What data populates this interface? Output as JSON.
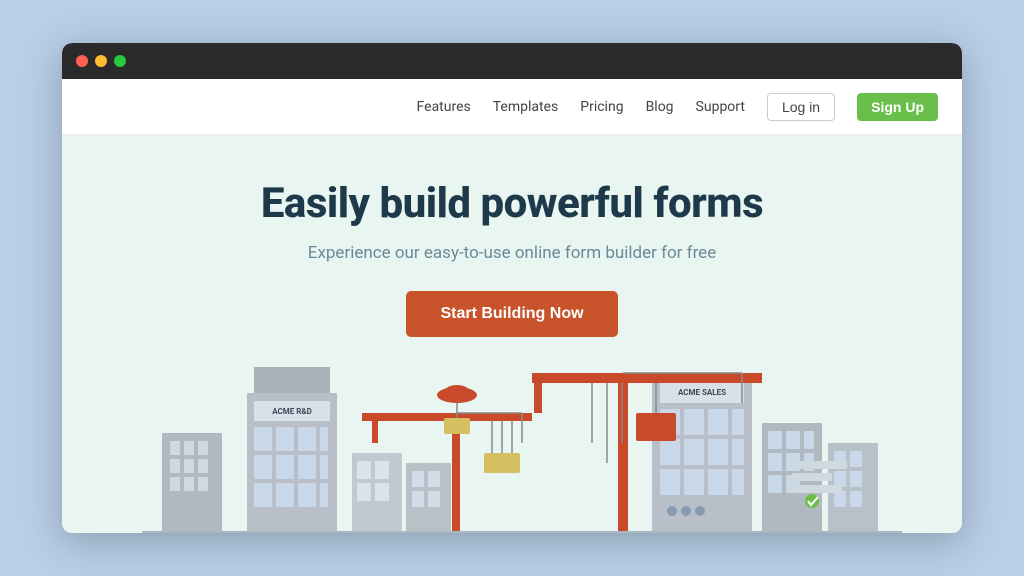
{
  "browser": {
    "dots": [
      "red",
      "yellow",
      "green"
    ]
  },
  "navbar": {
    "links": [
      {
        "label": "Features",
        "name": "features"
      },
      {
        "label": "Templates",
        "name": "templates"
      },
      {
        "label": "Pricing",
        "name": "pricing"
      },
      {
        "label": "Blog",
        "name": "blog"
      },
      {
        "label": "Support",
        "name": "support"
      }
    ],
    "login_label": "Log in",
    "signup_label": "Sign Up"
  },
  "hero": {
    "title": "Easily build powerful forms",
    "subtitle": "Experience our easy-to-use online form builder for free",
    "cta_label": "Start Building Now"
  }
}
